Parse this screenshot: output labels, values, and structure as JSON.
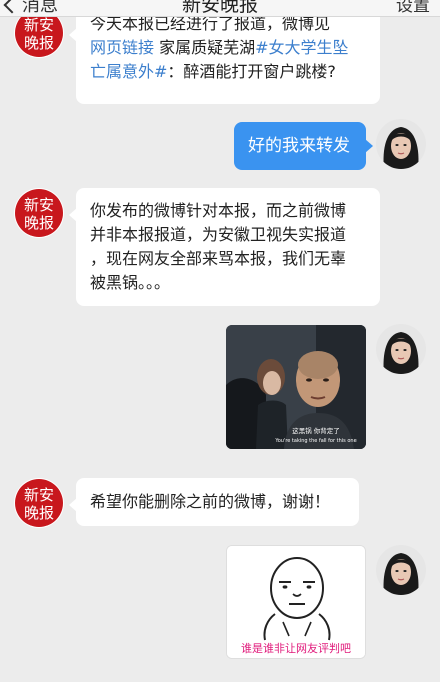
{
  "nav": {
    "back_label": "消息",
    "title": "新安晚报",
    "settings_label": "设置"
  },
  "avatars": {
    "brand_text_top": "新安",
    "brand_text_bottom": "晚报",
    "brand_color": "#c8171d"
  },
  "messages": {
    "m1": {
      "line1": "今天本报已经进行了报道，微博见",
      "link_label": "网页链接",
      "text_after_link": " 家属质疑芜湖",
      "hashtag1": "#女大学生坠",
      "hashtag2": "亡属意外#",
      "tail": "：醉酒能打开窗户跳楼?"
    },
    "m2": {
      "text": "好的我来转发"
    },
    "m3": {
      "line1": "你发布的微博针对本报，而之前微博",
      "line2": "并非本报报道，为安徽卫视失实报道",
      "line3": "，现在网友全部来骂本报，我们无辜",
      "line4": "被黑锅。。。"
    },
    "m4": {
      "subtitle_cn": "这黑锅 你背定了",
      "subtitle_en": "You're taking the fall for this one"
    },
    "m5": {
      "text": "希望你能删除之前的微博，谢谢！"
    },
    "m6": {
      "caption": "谁是谁非让网友评判吧"
    }
  },
  "colors": {
    "accent": "#3a93f0",
    "link": "#3c7fcd",
    "background": "#ececec",
    "meme_caption": "#e0187a"
  }
}
